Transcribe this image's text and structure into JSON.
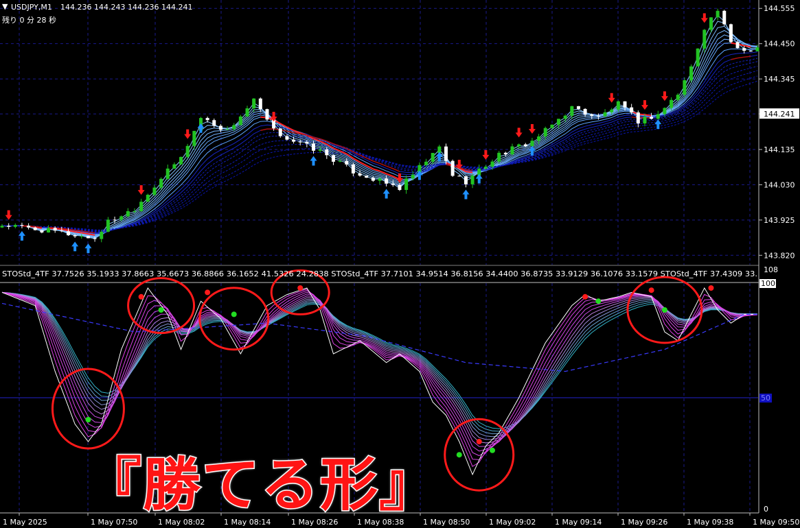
{
  "symbol_header": {
    "symbol": "USDJPY,M1",
    "ohlc": "144.236 144.243 144.236 144.241",
    "timer": "残り 0 分 28 秒"
  },
  "indicator_header": {
    "label": "STOStd_4TF 37.7526 35.1933 37.8663 35.6673 36.8866 36.1652 41.5326 24.2838 STOStd_4TF 37.7101 34.9514 36.8156 34.4400 36.8735 33.9129 36.1076 33.1579 STOStd_4TF 37.4309 33."
  },
  "banner_text": "『勝てる形』",
  "colors": {
    "bull_candle": "#22c322",
    "bear_candle": "#ffffff",
    "grid": "#1a1a8c",
    "signal_up": "#1e90ff",
    "signal_down": "#ff1a1a",
    "circle": "#ff1a1a",
    "stoch_main": "#ffffff"
  },
  "chart_data": [
    {
      "type": "candlestick",
      "title": "USDJPY,M1",
      "y_ticks": [
        "144.555",
        "144.450",
        "144.345",
        "144.241",
        "144.135",
        "144.030",
        "143.925",
        "143.820"
      ],
      "current_price": "144.241",
      "ylim": [
        143.79,
        144.58
      ],
      "x_ticks": [
        "1 May 2025",
        "1 May 07:50",
        "1 May 08:02",
        "1 May 08:14",
        "1 May 08:26",
        "1 May 08:38",
        "1 May 08:50",
        "1 May 09:02",
        "1 May 09:14",
        "1 May 09:26",
        "1 May 09:38",
        "1 May 09:50"
      ],
      "path": [
        [
          0,
          143.91
        ],
        [
          8,
          143.89
        ],
        [
          14,
          143.87
        ],
        [
          16,
          143.92
        ],
        [
          20,
          143.96
        ],
        [
          24,
          144.05
        ],
        [
          27,
          144.11
        ],
        [
          30,
          144.23
        ],
        [
          34,
          144.19
        ],
        [
          38,
          144.28
        ],
        [
          41,
          144.19
        ],
        [
          44,
          144.16
        ],
        [
          48,
          144.13
        ],
        [
          53,
          144.07
        ],
        [
          57,
          144.04
        ],
        [
          60,
          144.02
        ],
        [
          63,
          144.08
        ],
        [
          66,
          144.14
        ],
        [
          68,
          144.06
        ],
        [
          70,
          144.04
        ],
        [
          75,
          144.12
        ],
        [
          80,
          144.16
        ],
        [
          82,
          144.19
        ],
        [
          86,
          144.26
        ],
        [
          90,
          144.23
        ],
        [
          93,
          144.27
        ],
        [
          96,
          144.22
        ],
        [
          99,
          144.24
        ],
        [
          102,
          144.3
        ],
        [
          104,
          144.38
        ],
        [
          106,
          144.5
        ],
        [
          108,
          144.55
        ],
        [
          110,
          144.45
        ],
        [
          112,
          144.43
        ],
        [
          114,
          144.44
        ]
      ]
    },
    {
      "type": "line",
      "title": "STOStd_4TF",
      "y_ticks": [
        "108",
        "100",
        "50",
        "0"
      ],
      "ylim": [
        0,
        108
      ],
      "level_line": 50,
      "path": [
        [
          0,
          98
        ],
        [
          5,
          92
        ],
        [
          8,
          62
        ],
        [
          11,
          38
        ],
        [
          13,
          30
        ],
        [
          15,
          38
        ],
        [
          18,
          72
        ],
        [
          22,
          100
        ],
        [
          25,
          88
        ],
        [
          27,
          72
        ],
        [
          30,
          94
        ],
        [
          33,
          86
        ],
        [
          36,
          70
        ],
        [
          40,
          92
        ],
        [
          43,
          97
        ],
        [
          46,
          100
        ],
        [
          48,
          90
        ],
        [
          50,
          70
        ],
        [
          54,
          76
        ],
        [
          58,
          66
        ],
        [
          60,
          70
        ],
        [
          63,
          62
        ],
        [
          65,
          48
        ],
        [
          67,
          42
        ],
        [
          69,
          30
        ],
        [
          71,
          15
        ],
        [
          73,
          28
        ],
        [
          75,
          34
        ],
        [
          78,
          50
        ],
        [
          82,
          75
        ],
        [
          86,
          92
        ],
        [
          88,
          97
        ],
        [
          90,
          94
        ],
        [
          93,
          96
        ],
        [
          95,
          98
        ],
        [
          98,
          96
        ],
        [
          100,
          80
        ],
        [
          102,
          76
        ],
        [
          104,
          88
        ],
        [
          106,
          100
        ],
        [
          108,
          90
        ],
        [
          110,
          84
        ],
        [
          112,
          88
        ]
      ],
      "signal_curve": [
        [
          0,
          93
        ],
        [
          20,
          80
        ],
        [
          40,
          84
        ],
        [
          55,
          78
        ],
        [
          70,
          66
        ],
        [
          85,
          62
        ],
        [
          100,
          72
        ],
        [
          112,
          88
        ]
      ]
    }
  ]
}
